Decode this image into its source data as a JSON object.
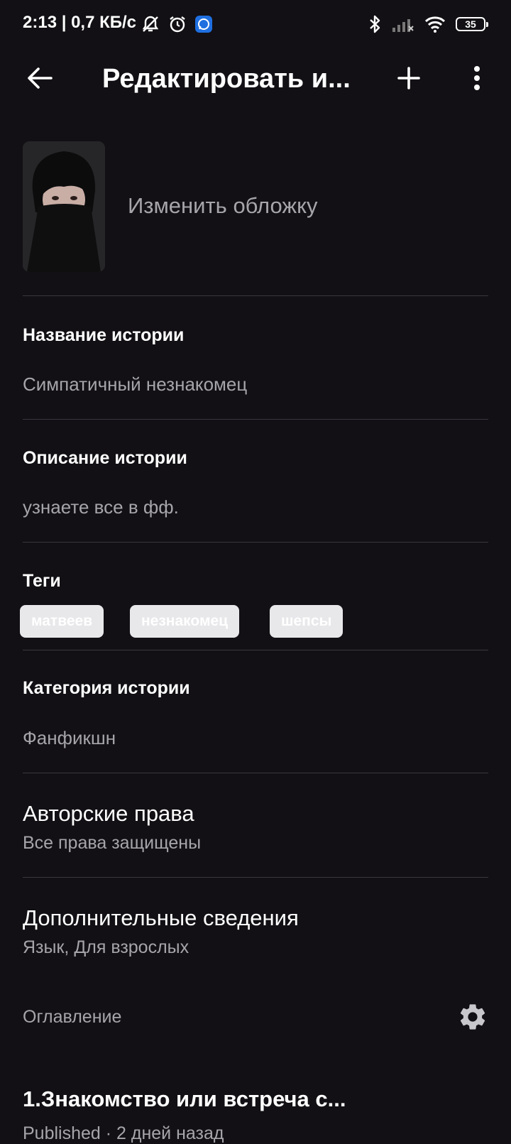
{
  "status_bar": {
    "time": "2:13 | 0,7 КБ/с",
    "battery": "35",
    "icons": [
      "mute-notifications-icon",
      "alarm-icon",
      "whatsapp-icon",
      "bluetooth-icon",
      "signal-icon",
      "wifi-icon",
      "battery-icon"
    ]
  },
  "toolbar": {
    "title": "Редактировать и...",
    "icons": [
      "back-arrow-icon",
      "plus-icon",
      "more-vertical-icon"
    ]
  },
  "cover": {
    "change_label": "Изменить обложку"
  },
  "story": {
    "title_label": "Название истории",
    "title_value": "Симпатичный незнакомец",
    "description_label": "Описание истории",
    "description_value": "узнаете все в фф.",
    "tags_label": "Теги",
    "tags": [
      "матвеев",
      "незнакомец",
      "шепсы"
    ],
    "category_label": "Категория истории",
    "category_value": "Фанфикшн",
    "copyright_label": "Авторские права",
    "copyright_value": "Все права защищены",
    "details_label": "Дополнительные сведения",
    "details_value": "Язык, Для взрослых"
  },
  "toc": {
    "label": "Оглавление",
    "gear_icon": "gear-icon",
    "parts": [
      {
        "title": "1.Знакомство или встреча с...",
        "status": "Published · 2 дней назад"
      }
    ]
  },
  "colors": {
    "background": "#121014",
    "text_primary": "#ffffff",
    "text_secondary": "#a6a5aa",
    "divider": "#3a383e",
    "tag_background": "#e8e7ea"
  }
}
